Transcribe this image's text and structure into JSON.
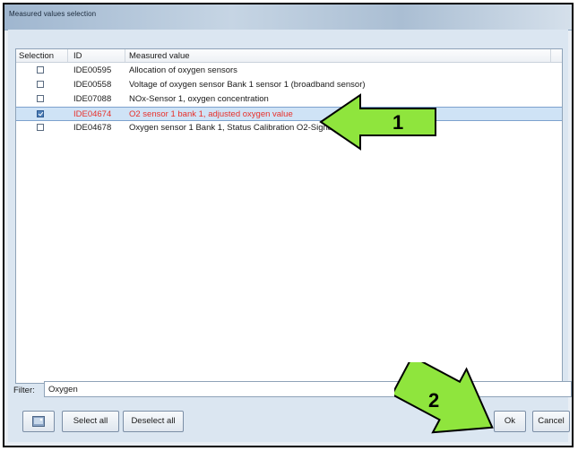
{
  "window": {
    "title": "Measured values selection"
  },
  "table": {
    "headers": {
      "selection": "Selection",
      "id": "ID",
      "value": "Measured value"
    },
    "rows": [
      {
        "id": "IDE00595",
        "value": "Allocation of oxygen sensors",
        "checked": false,
        "selected": false
      },
      {
        "id": "IDE00558",
        "value": "Voltage of oxygen sensor Bank 1 sensor 1 (broadband sensor)",
        "checked": false,
        "selected": false
      },
      {
        "id": "IDE07088",
        "value": "NOx-Sensor 1, oxygen concentration",
        "checked": false,
        "selected": false
      },
      {
        "id": "IDE04674",
        "value": "O2 sensor 1 bank 1, adjusted oxygen value",
        "checked": true,
        "selected": true
      },
      {
        "id": "IDE04678",
        "value": "Oxygen sensor 1 Bank 1, Status Calibration O2-Signal",
        "checked": false,
        "selected": false
      }
    ]
  },
  "filter": {
    "label": "Filter:",
    "value": "Oxygen"
  },
  "buttons": {
    "icon": "image-icon",
    "select_all": "Select all",
    "deselect_all": "Deselect all",
    "ok": "Ok",
    "cancel": "Cancel"
  },
  "annotations": {
    "arrow1": "1",
    "arrow2": "2"
  },
  "colors": {
    "arrow_fill": "#8fe53d",
    "selected_text": "#e8302a",
    "selected_row": "#cfe3f6"
  }
}
